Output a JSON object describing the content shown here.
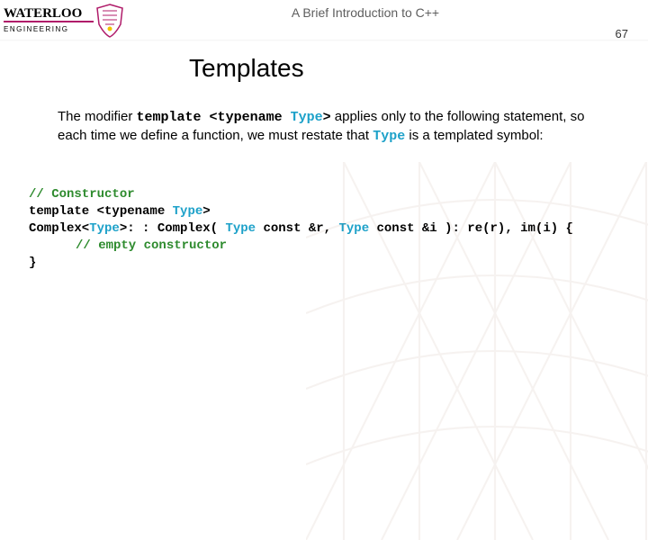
{
  "header": {
    "institution": "WATERLOO",
    "department": "ENGINEERING",
    "course_title": "A Brief Introduction to C++",
    "page_number": "67"
  },
  "slide": {
    "title": "Templates",
    "paragraph": {
      "p1": "The modifier ",
      "mono1": "template <typename ",
      "tpl1": "Type",
      "mono2": ">",
      "p2": " applies only to the following statement, so each time we define a function, we must restate that ",
      "tpl2": "Type",
      "p3": " is a templated symbol:"
    },
    "code": {
      "c1": "// Constructor",
      "l2a": "template <typename ",
      "l2b": "Type",
      "l2c": ">",
      "l3a": "Complex<",
      "l3b": "Type",
      "l3c": ">: : Complex( ",
      "l3d": "Type",
      "l3e": " const &r, ",
      "l3f": "Type",
      "l3g": " const &i ): re(r), im(i) {",
      "c4": "// empty constructor",
      "l5": "}"
    }
  }
}
